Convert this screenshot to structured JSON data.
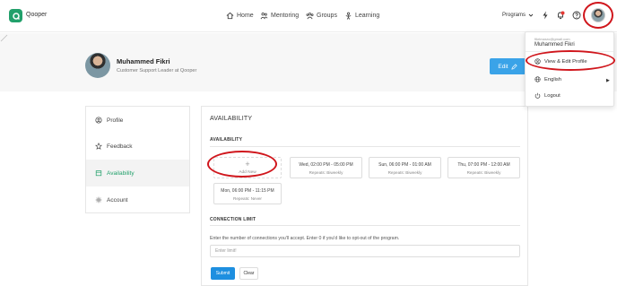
{
  "app": {
    "brand": "Qooper"
  },
  "nav": {
    "home": "Home",
    "mentoring": "Mentoring",
    "groups": "Groups",
    "learning": "Learning"
  },
  "topbar": {
    "programs": "Programs",
    "icons": [
      "bolt-icon",
      "bell-icon",
      "help-icon"
    ],
    "notification_color": "#e53935"
  },
  "profile": {
    "name": "Muhammed Fikri",
    "title": "Customer Support Leader at Qooper",
    "edit_label": "Edit"
  },
  "sidebar": {
    "items": [
      {
        "label": "Profile",
        "icon": "user-circle-icon"
      },
      {
        "label": "Feedback",
        "icon": "star-icon"
      },
      {
        "label": "Availability",
        "icon": "calendar-icon",
        "active": true
      },
      {
        "label": "Account",
        "icon": "settings-icon"
      }
    ]
  },
  "availability": {
    "title": "AVAILABILITY",
    "section": "AVAILABILITY",
    "add_new": "Add New",
    "slots": [
      {
        "time": "Wed, 02:00 PM - 05:00 PM",
        "repeat": "Repeats: Biweekly"
      },
      {
        "time": "Sun, 06:00 PM - 01:00 AM",
        "repeat": "Repeats: Biweekly"
      },
      {
        "time": "Thu, 07:00 PM - 12:00 AM",
        "repeat": "Repeats: Biweekly"
      },
      {
        "time": "Mon, 06:00 PM - 11:15 PM",
        "repeat": "Repeats: Never"
      }
    ]
  },
  "connection": {
    "heading": "CONNECTION LIMIT",
    "description": "Enter the number of connections you'll accept. Enter 0 if you'd like to opt-out of the program.",
    "placeholder": "Enter limit!",
    "submit": "Submit",
    "clear": "Clear"
  },
  "dropdown": {
    "email": "fikrimarzo@gmail.com",
    "name": "Muhammed Fikri",
    "items": [
      {
        "label": "View & Edit Profile",
        "icon": "user-circle-icon"
      },
      {
        "label": "English",
        "icon": "globe-icon"
      },
      {
        "label": "Logout",
        "icon": "power-icon"
      }
    ]
  },
  "colors": {
    "brand": "#22a06b",
    "accent": "#3aa3e8",
    "submit": "#1e8fe0",
    "highlight_ring": "#d0161c"
  }
}
